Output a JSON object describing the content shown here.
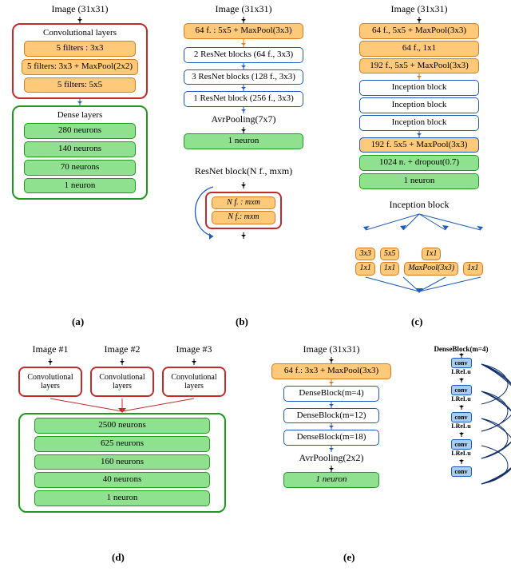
{
  "a": {
    "image": "Image (31x31)",
    "conv_label": "Convolutional layers",
    "conv": [
      "5 filters : 3x3",
      "5 filters: 3x3 + MaxPool(2x2)",
      "5 filters: 5x5"
    ],
    "dense_label": "Dense layers",
    "dense": [
      "280 neurons",
      "140 neurons",
      "70 neurons",
      "1 neuron"
    ]
  },
  "b": {
    "image": "Image (31x31)",
    "stem": "64 f. : 5x5 + MaxPool(3x3)",
    "blocks": [
      "2 ResNet blocks (64 f., 3x3)",
      "3 ResNet blocks (128 f., 3x3)",
      "1 ResNet block (256 f., 3x3)"
    ],
    "pool": "AvrPooling(7x7)",
    "out": "1 neuron",
    "legend_title": "ResNet block(N f., mxm)",
    "legend_items": [
      "N f. : mxm",
      "N f.: mxm"
    ]
  },
  "c": {
    "image": "Image (31x31)",
    "stems": [
      "64 f., 5x5 + MaxPool(3x3)",
      "64 f., 1x1",
      "192 f., 5x5 + MaxPool(3x3)"
    ],
    "inc": [
      "Inception block",
      "Inception block",
      "Inception block"
    ],
    "stem2": "192 f. 5x5 + MaxPool(3x3)",
    "dense": "1024 n. + dropout(0.7)",
    "out": "1 neuron",
    "legend_title": "Inception block",
    "branches": [
      [
        "3x3",
        "1x1"
      ],
      [
        "5x5",
        "1x1"
      ],
      [
        "1x1",
        "MaxPool(3x3)"
      ],
      [
        "1x1"
      ]
    ]
  },
  "d": {
    "images": [
      "Image #1",
      "Image #2",
      "Image #3"
    ],
    "conv": "Convolutional layers",
    "dense": [
      "2500 neurons",
      "625 neurons",
      "160 neurons",
      "40 neurons",
      "1 neuron"
    ]
  },
  "e": {
    "image": "Image (31x31)",
    "stem": "64 f.: 3x3 + MaxPool(3x3)",
    "blocks": [
      "DenseBlock(m=4)",
      "DenseBlock(m=12)",
      "DenseBlock(m=18)"
    ],
    "pool": "AvrPooling(2x2)",
    "out": "1 neuron",
    "legend_title": "DenseBlock(m=4)",
    "legend_nodes": [
      "conv",
      "LReLu",
      "conv",
      "LReLu",
      "conv",
      "LReLu",
      "conv",
      "LReLu",
      "conv"
    ]
  },
  "captions": {
    "a": "(a)",
    "b": "(b)",
    "c": "(c)",
    "d": "(d)",
    "e": "(e)"
  }
}
